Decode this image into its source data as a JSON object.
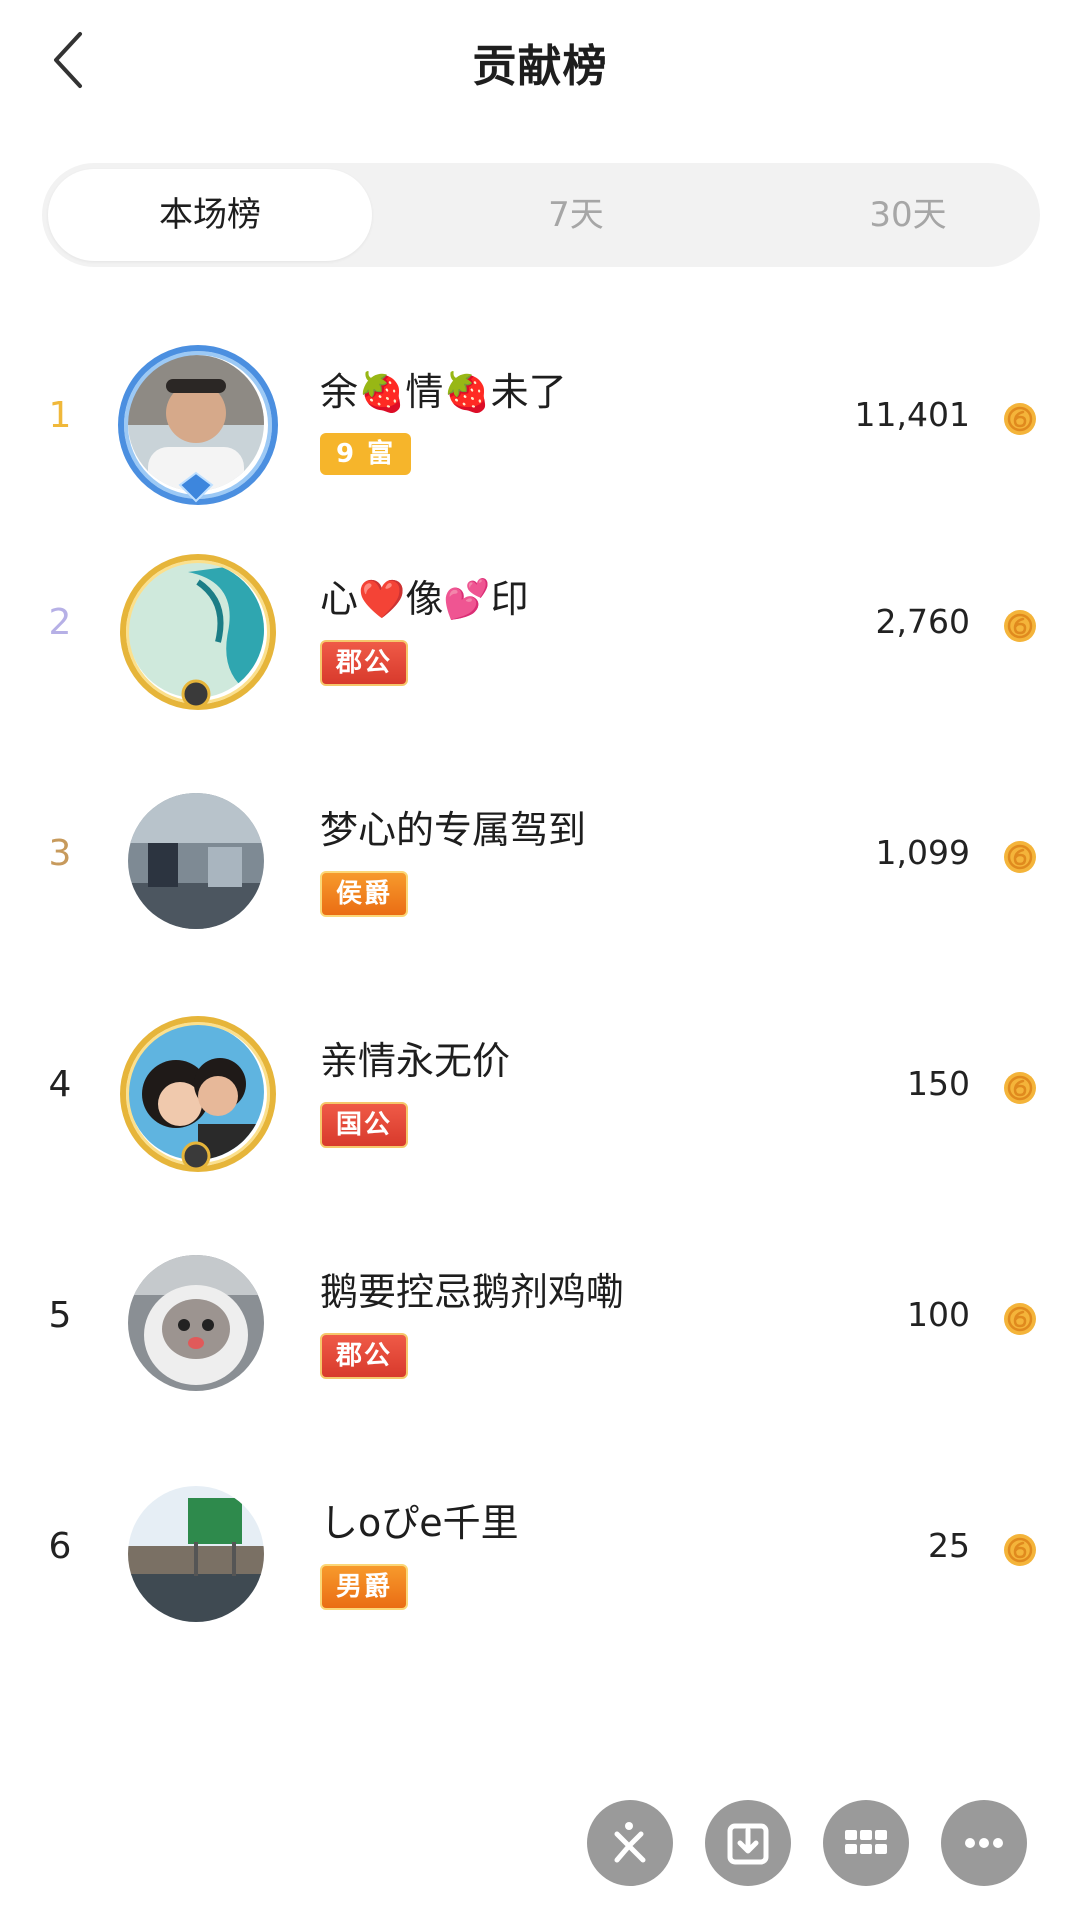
{
  "header": {
    "title": "贡献榜"
  },
  "tabs": [
    {
      "label": "本场榜",
      "active": true
    },
    {
      "label": "7天",
      "active": false
    },
    {
      "label": "30天",
      "active": false
    }
  ],
  "leaderboard": [
    {
      "rank": "1",
      "name": "余🍓情🍓未了",
      "badge": "9 富",
      "score": "11,401"
    },
    {
      "rank": "2",
      "name": "心❤️像💕印",
      "badge": "郡公",
      "score": "2,760"
    },
    {
      "rank": "3",
      "name": "梦心的专属驾到",
      "badge": "侯爵",
      "score": "1,099"
    },
    {
      "rank": "4",
      "name": "亲情永无价",
      "badge": "国公",
      "score": "150"
    },
    {
      "rank": "5",
      "name": "鹅要控忌鹅剂鸡嘞",
      "badge": "郡公",
      "score": "100"
    },
    {
      "rank": "6",
      "name": "しoぴe千里",
      "badge": "男爵",
      "score": "25"
    }
  ],
  "colors": {
    "rank1": "#f0b83a",
    "rank2": "#b6b0e6",
    "rank3": "#c79a5c",
    "coin": "#f0a83a",
    "fab": "#9a9a9a"
  },
  "icons": {
    "back": "chevron-left-icon",
    "coin": "coin-icon",
    "actions": [
      "kuaishou-share-icon",
      "download-icon",
      "grid-icon",
      "more-icon"
    ]
  }
}
